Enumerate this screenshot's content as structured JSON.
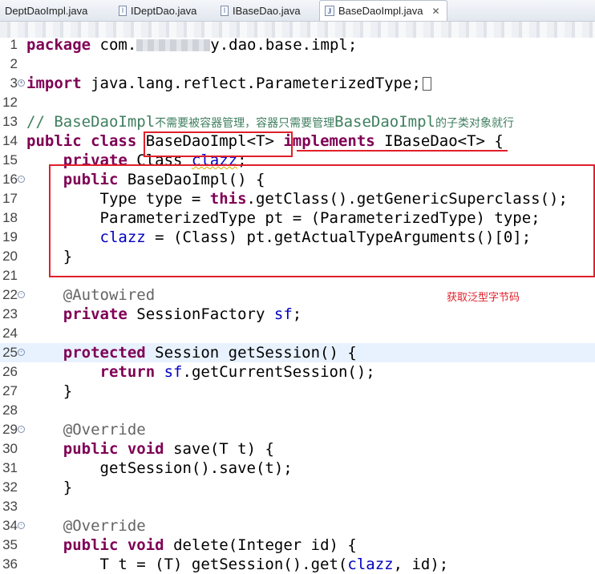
{
  "tabs": [
    {
      "label": "DeptDaoImpl.java",
      "icon": "java-class-icon",
      "active": false
    },
    {
      "label": "IDeptDao.java",
      "icon": "java-interface-icon",
      "active": false
    },
    {
      "label": "IBaseDao.java",
      "icon": "java-interface-icon",
      "active": false
    },
    {
      "label": "BaseDaoImpl.java",
      "icon": "java-class-icon",
      "active": true
    }
  ],
  "tab_close_glyph": "✕",
  "editor": {
    "lines": [
      {
        "num": "1",
        "parts": [
          [
            "kw",
            "package"
          ],
          [
            "t",
            " com."
          ],
          [
            "blur",
            ""
          ],
          [
            "t",
            "y.dao.base.impl;"
          ]
        ]
      },
      {
        "num": "2",
        "parts": []
      },
      {
        "num": "3",
        "fold": "+",
        "parts": [
          [
            "kw",
            "import"
          ],
          [
            "t",
            " java.lang.reflect.ParameterizedType;"
          ],
          [
            "sq",
            ""
          ]
        ]
      },
      {
        "num": "12",
        "parts": []
      },
      {
        "num": "13",
        "parts": [
          [
            "cmt",
            "// BaseDaoImpl"
          ],
          [
            "cjk",
            "不需要被容器管理，容器只需要管理"
          ],
          [
            "cmt",
            "BaseDaoImpl"
          ],
          [
            "cjk",
            "的子类对象就行"
          ]
        ]
      },
      {
        "num": "14",
        "parts": [
          [
            "kw",
            "public"
          ],
          [
            "t",
            " "
          ],
          [
            "kw",
            "class"
          ],
          [
            "t",
            " BaseDaoImpl<T> "
          ],
          [
            "kw",
            "implements"
          ],
          [
            "t",
            " IBaseDao<T> {"
          ]
        ]
      },
      {
        "num": "15",
        "parts": [
          [
            "t",
            "    "
          ],
          [
            "kw",
            "private"
          ],
          [
            "t",
            " Class "
          ],
          [
            "fldw",
            "clazz"
          ],
          [
            "t",
            ";"
          ]
        ]
      },
      {
        "num": "16",
        "fold": "-",
        "parts": [
          [
            "t",
            "    "
          ],
          [
            "kw",
            "public"
          ],
          [
            "t",
            " BaseDaoImpl() {"
          ]
        ]
      },
      {
        "num": "17",
        "parts": [
          [
            "t",
            "        Type type = "
          ],
          [
            "kw",
            "this"
          ],
          [
            "t",
            ".getClass().getGenericSuperclass();"
          ]
        ]
      },
      {
        "num": "18",
        "parts": [
          [
            "t",
            "        ParameterizedType pt = (ParameterizedType) type;"
          ]
        ]
      },
      {
        "num": "19",
        "parts": [
          [
            "t",
            "        "
          ],
          [
            "fld",
            "clazz"
          ],
          [
            "t",
            " = (Class) pt.getActualTypeArguments()[0];"
          ]
        ]
      },
      {
        "num": "20",
        "parts": [
          [
            "t",
            "    }"
          ]
        ]
      },
      {
        "num": "21",
        "parts": []
      },
      {
        "num": "22",
        "fold": "-",
        "parts": [
          [
            "t",
            "    "
          ],
          [
            "ann",
            "@Autowired"
          ]
        ]
      },
      {
        "num": "23",
        "parts": [
          [
            "t",
            "    "
          ],
          [
            "kw",
            "private"
          ],
          [
            "t",
            " SessionFactory "
          ],
          [
            "fld",
            "sf"
          ],
          [
            "t",
            ";"
          ]
        ]
      },
      {
        "num": "24",
        "parts": []
      },
      {
        "num": "25",
        "fold": "-",
        "highlight": true,
        "parts": [
          [
            "t",
            "    "
          ],
          [
            "kw",
            "protected"
          ],
          [
            "t",
            " Session getSession() {"
          ]
        ]
      },
      {
        "num": "26",
        "parts": [
          [
            "t",
            "        "
          ],
          [
            "kw",
            "return"
          ],
          [
            "t",
            " "
          ],
          [
            "fld",
            "sf"
          ],
          [
            "t",
            ".getCurrentSession();"
          ]
        ]
      },
      {
        "num": "27",
        "parts": [
          [
            "t",
            "    }"
          ]
        ]
      },
      {
        "num": "28",
        "parts": []
      },
      {
        "num": "29",
        "fold": "-",
        "parts": [
          [
            "t",
            "    "
          ],
          [
            "ann",
            "@Override"
          ]
        ]
      },
      {
        "num": "30",
        "parts": [
          [
            "t",
            "    "
          ],
          [
            "kw",
            "public"
          ],
          [
            "t",
            " "
          ],
          [
            "kw",
            "void"
          ],
          [
            "t",
            " save(T t) {"
          ]
        ]
      },
      {
        "num": "31",
        "parts": [
          [
            "t",
            "        getSession().save(t);"
          ]
        ]
      },
      {
        "num": "32",
        "parts": [
          [
            "t",
            "    }"
          ]
        ]
      },
      {
        "num": "33",
        "parts": []
      },
      {
        "num": "34",
        "fold": "-",
        "parts": [
          [
            "t",
            "    "
          ],
          [
            "ann",
            "@Override"
          ]
        ]
      },
      {
        "num": "35",
        "parts": [
          [
            "t",
            "    "
          ],
          [
            "kw",
            "public"
          ],
          [
            "t",
            " "
          ],
          [
            "kw",
            "void"
          ],
          [
            "t",
            " delete(Integer id) {"
          ]
        ]
      },
      {
        "num": "36",
        "parts": [
          [
            "t",
            "        T t = (T) getSession().get("
          ],
          [
            "fld",
            "clazz"
          ],
          [
            "t",
            ", id);"
          ]
        ]
      }
    ]
  },
  "annotation_note": "获取泛型字节码",
  "colors": {
    "keyword": "#7f0055",
    "field": "#0000c0",
    "annotation": "#646464",
    "comment": "#3f7f5f",
    "markup_red": "#e0202a",
    "current_line": "#e8f2fe"
  }
}
